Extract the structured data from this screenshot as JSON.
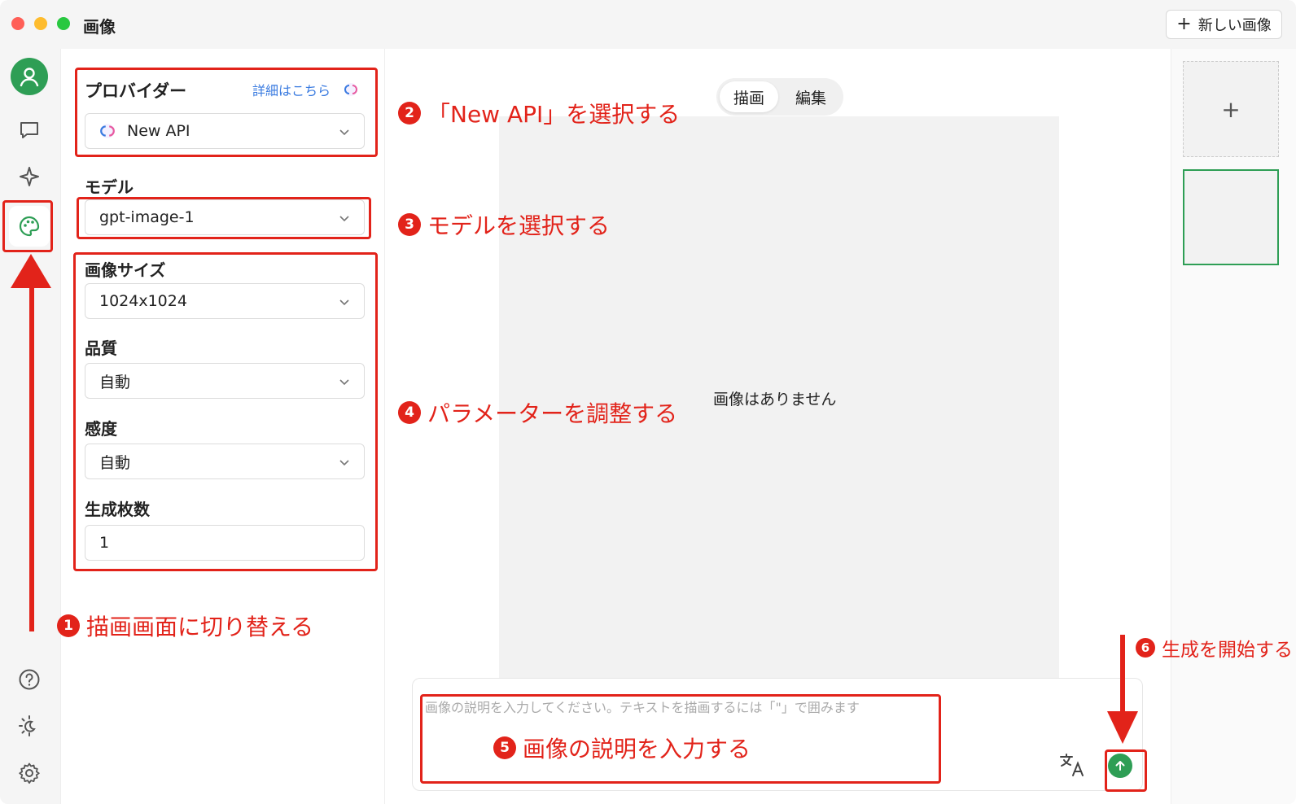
{
  "window": {
    "title": "画像",
    "new_image_button": "新しい画像"
  },
  "panel": {
    "provider_label": "プロバイダー",
    "detail_link": "詳細はこちら",
    "provider_value": "New API",
    "model_label": "モデル",
    "model_value": "gpt-image-1",
    "size_label": "画像サイズ",
    "size_value": "1024x1024",
    "quality_label": "品質",
    "quality_value": "自動",
    "sensitivity_label": "感度",
    "sensitivity_value": "自動",
    "count_label": "生成枚数",
    "count_value": "1"
  },
  "main": {
    "tabs": [
      {
        "label": "描画"
      },
      {
        "label": "編集"
      }
    ],
    "empty_text": "画像はありません",
    "prompt_placeholder": "画像の説明を入力してください。テキストを描画するには「\"」で囲みます"
  },
  "rightbar": {
    "add_symbol": "+"
  },
  "annotations": [
    {
      "num": "1",
      "text": "描画画面に切り替える"
    },
    {
      "num": "2",
      "text": "「New API」を選択する"
    },
    {
      "num": "3",
      "text": "モデルを選択する"
    },
    {
      "num": "4",
      "text": "パラメーターを調整する"
    },
    {
      "num": "5",
      "text": "画像の説明を入力する"
    },
    {
      "num": "6",
      "text": "生成を開始する"
    }
  ],
  "colors": {
    "accent_green": "#2e9e55",
    "annotation_red": "#e2231a",
    "link_blue": "#3a7be0"
  },
  "icons": {
    "rail": [
      "user-icon",
      "chat-icon",
      "sparkle-icon",
      "palette-icon",
      "help-icon",
      "theme-icon",
      "settings-icon"
    ],
    "provider": "new-api-logo-icon",
    "translate": "translate-icon",
    "send": "arrow-up-icon"
  }
}
